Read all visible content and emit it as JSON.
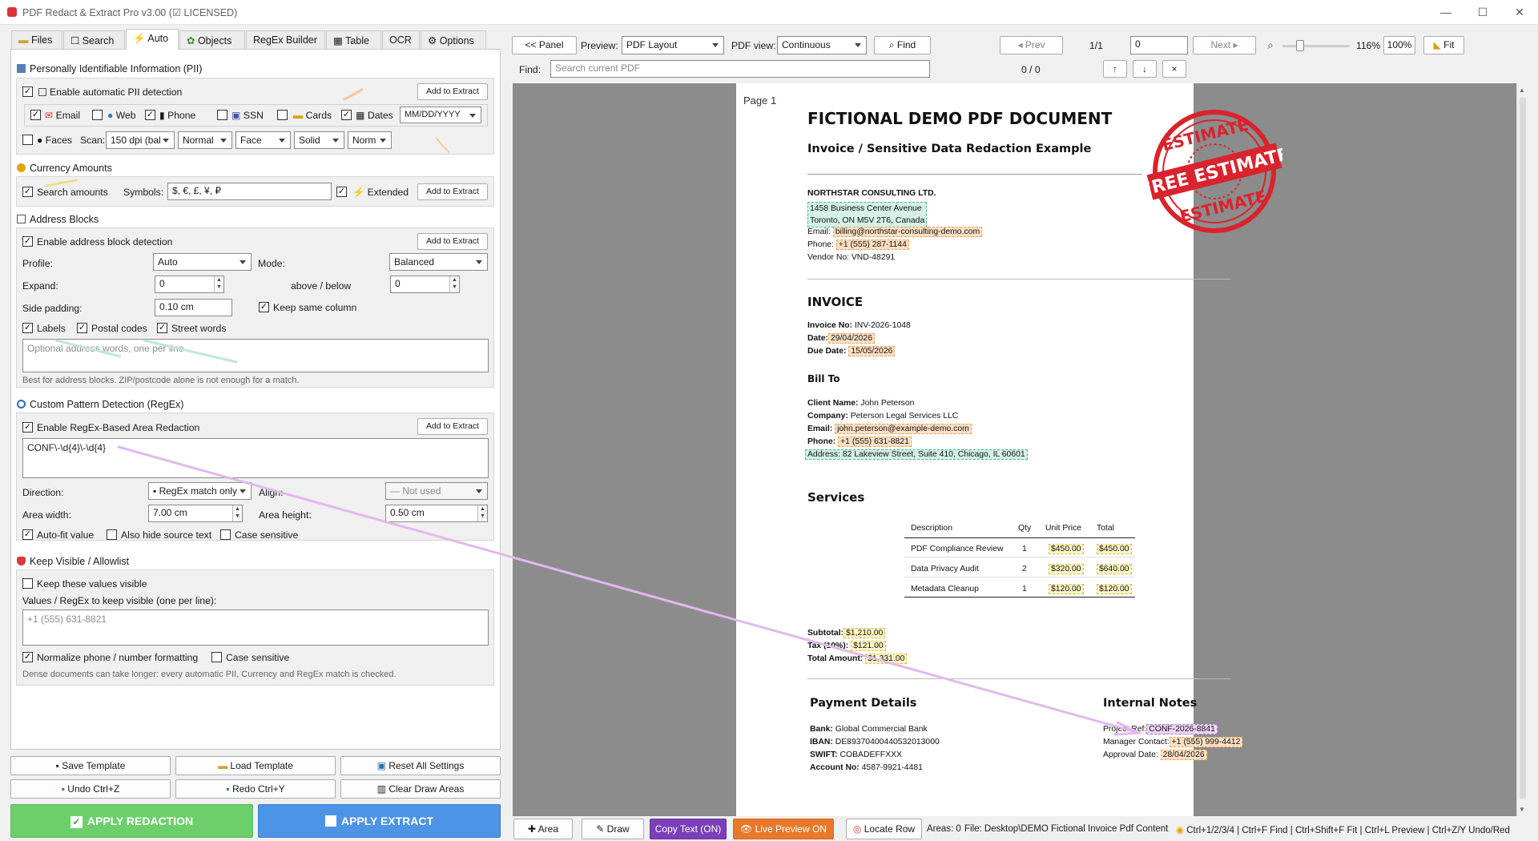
{
  "window": {
    "title": "PDF Redact & Extract Pro v3.00 (☑ LICENSED)",
    "min": "—",
    "max": "☐",
    "close": "✕"
  },
  "tabs": [
    {
      "label": "Files",
      "icon": "folder-icon"
    },
    {
      "label": "Search",
      "icon": "search-icon"
    },
    {
      "label": "Auto",
      "icon": "lightning-icon"
    },
    {
      "label": "Objects",
      "icon": "objects-icon"
    },
    {
      "label": "RegEx Builder",
      "icon": ""
    },
    {
      "label": "Table",
      "icon": "table-icon"
    },
    {
      "label": "OCR",
      "icon": ""
    },
    {
      "label": "Options",
      "icon": "gear-icon"
    }
  ],
  "pii": {
    "header": "Personally Identifiable Information (PII)",
    "enable": "Enable automatic PII detection",
    "add": "Add to Extract",
    "email": "Email",
    "web": "Web",
    "phone": "Phone",
    "ssn": "SSN",
    "cards": "Cards",
    "dates": "Dates",
    "date_format": "MM/DD/YYYY",
    "faces": "Faces",
    "scan": "Scan:",
    "dpi": "150 dpi (bal",
    "normal": "Normal",
    "face": "Face",
    "solid": "Solid",
    "norm": "Norm"
  },
  "currency": {
    "header": "Currency Amounts",
    "search": "Search amounts",
    "symbols_label": "Symbols:",
    "symbols": "$, €, £, ¥, ₽",
    "extended": "Extended",
    "add": "Add to Extract"
  },
  "address": {
    "header": "Address Blocks",
    "enable": "Enable address block detection",
    "add": "Add to Extract",
    "profile_label": "Profile:",
    "profile": "Auto",
    "mode_label": "Mode:",
    "mode": "Balanced",
    "expand_label": "Expand:",
    "expand": "0",
    "above_below": "above / below",
    "above_val": "0",
    "side_label": "Side padding:",
    "side": "0.10 cm",
    "keep_col": "Keep same column",
    "labels": "Labels",
    "postal": "Postal codes",
    "street": "Street words",
    "placeholder": "Optional address words, one per line",
    "hint": "Best for address blocks. ZIP/postcode alone is not enough for a match."
  },
  "regex": {
    "header": "Custom Pattern Detection (RegEx)",
    "enable": "Enable RegEx-Based Area Redaction",
    "add": "Add to Extract",
    "pattern": "CONF\\-\\d{4}\\-\\d{4}",
    "direction_label": "Direction:",
    "direction": "▪ RegEx match only",
    "align_label": "Align:",
    "align": "— Not used",
    "width_label": "Area width:",
    "width": "7.00 cm",
    "height_label": "Area height:",
    "height": "0.50 cm",
    "autofit": "Auto-fit value",
    "hide": "Also hide source text",
    "case": "Case sensitive"
  },
  "keep": {
    "header": "Keep Visible / Allowlist",
    "keep_values": "Keep these values visible",
    "values_label": "Values / RegEx to keep visible (one per line):",
    "placeholder": "+1 (555) 631-8821",
    "normalize": "Normalize phone / number formatting",
    "case": "Case sensitive",
    "hint": "Dense documents can take longer: every automatic PII, Currency and RegEx match is checked."
  },
  "bottom": {
    "save": "Save Template",
    "load": "Load Template",
    "reset": "Reset All Settings",
    "undo": "Undo  Ctrl+Z",
    "redo": "Redo  Ctrl+Y",
    "clear": "Clear Draw Areas",
    "apply_red": "APPLY REDACTION",
    "apply_ext": "APPLY EXTRACT"
  },
  "toolbar": {
    "panel": "<< Panel",
    "preview_label": "Preview:",
    "preview": "PDF Layout",
    "view_label": "PDF view:",
    "view": "Continuous",
    "find_btn": "Find",
    "prev": "◂ Prev",
    "page_count": "1/1",
    "page_input": "0",
    "next": "Next ▸",
    "zoom_pct": "116%",
    "zoom100": "100%",
    "fit": "Fit",
    "find_label": "Find:",
    "find_placeholder": "Search current PDF",
    "match_count": "0 / 0",
    "up": "↑",
    "down": "↓",
    "x": "×"
  },
  "statusbar": {
    "area": "✚ Area",
    "draw": "✎ Draw",
    "copy": "Copy Text (ON)",
    "live": "👁 Live Preview ON",
    "locate": "Locate Row",
    "areas": "Areas: 0",
    "file": "File: Desktop\\DEMO Fictional Invoice Pdf Content",
    "shortcuts": "Ctrl+1/2/3/4 | Ctrl+F Find | Ctrl+Shift+F Fit | Ctrl+L Preview | Ctrl+Z/Y Undo/Red"
  },
  "colors": {
    "accent_green": "#6ccf6c",
    "accent_blue": "#4d93e6",
    "copy_purple": "#7b3fb8",
    "live_orange": "#e8792a",
    "stamp_red": "#d9232d"
  },
  "pdf": {
    "page_label": "Page 1",
    "title": "FICTIONAL DEMO PDF DOCUMENT",
    "subtitle": "Invoice / Sensitive Data Redaction Example",
    "stamp_top": "ESTIMATE",
    "stamp_mid": "FREE ESTIMATE",
    "stamp_bottom": "ESTIMATE",
    "company": "NORTHSTAR CONSULTING LTD.",
    "addr1": "1458 Business Center Avenue",
    "addr2": "Toronto, ON M5V 2T6, Canada",
    "email_label": "Email:",
    "email": "billing@northstar-consulting-demo.com",
    "phone_label": "Phone:",
    "phone": "+1 (555) 287-1144",
    "vendor": "Vendor No: VND-48291",
    "invoice_h": "INVOICE",
    "inv_no_label": "Invoice No:",
    "inv_no": "INV-2026-1048",
    "date_label": "Date:",
    "date": "29/04/2026",
    "due_label": "Due Date:",
    "due": "15/05/2026",
    "billto_h": "Bill To",
    "client_label": "Client Name:",
    "client": "John Peterson",
    "company_label": "Company:",
    "company2": "Peterson Legal Services LLC",
    "cemail_label": "Email:",
    "cemail": "john.peterson@example-demo.com",
    "cphone_label": "Phone:",
    "cphone": "+1 (555) 631-8821",
    "caddr": "Address: 82 Lakeview Street, Suite 410, Chicago, IL 60601",
    "services_h": "Services",
    "cols": [
      "Description",
      "Qty",
      "Unit Price",
      "Total"
    ],
    "rows": [
      {
        "desc": "PDF Compliance Review",
        "qty": "1",
        "unit": "$450.00",
        "total": "$450.00"
      },
      {
        "desc": "Data Privacy Audit",
        "qty": "2",
        "unit": "$320.00",
        "total": "$640.00"
      },
      {
        "desc": "Metadata Cleanup",
        "qty": "1",
        "unit": "$120.00",
        "total": "$120.00"
      }
    ],
    "subtotal_label": "Subtotal:",
    "subtotal": "$1,210.00",
    "tax_label": "Tax (10%):",
    "tax": "$121.00",
    "total_label": "Total Amount:",
    "total": "$1,331.00",
    "pay_h": "Payment Details",
    "bank_label": "Bank:",
    "bank": "Global Commercial Bank",
    "iban_label": "IBAN:",
    "iban": "DE89370400440532013000",
    "swift_label": "SWIFT:",
    "swift": "COBADEFFXXX",
    "acct_label": "Account No:",
    "acct": "4587-9921-4481",
    "notes_h": "Internal Notes",
    "ref_label": "Project Ref:",
    "ref": "CONF-2026-8841",
    "mgr_label": "Manager Contact:",
    "mgr": "+1 (555) 999-4412",
    "appr_label": "Approval Date:",
    "appr": "28/04/2026"
  }
}
